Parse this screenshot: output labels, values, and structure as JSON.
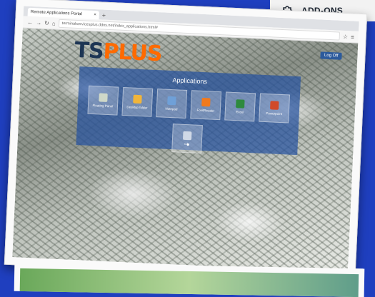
{
  "addons": {
    "label": "ADD-ONS",
    "icon": "puzzle-icon"
  },
  "browser": {
    "tab_title": "Remote Applications Portal",
    "url": "terminalservicesplus.ddns.net/index_applications.html#"
  },
  "page": {
    "logo_main": "TS",
    "logo_accent": "PLUS",
    "logoff_label": "Log Off",
    "panel_title": "Applications",
    "apps": [
      {
        "label": "Floating Panel",
        "color": "#cfd8c8"
      },
      {
        "label": "Desktop folder",
        "color": "#f1b53a"
      },
      {
        "label": "Notepad",
        "color": "#6fa0d8"
      },
      {
        "label": "FoxitReader",
        "color": "#f07a1e"
      },
      {
        "label": "Excel",
        "color": "#2e8a3e"
      },
      {
        "label": "Powerpoint",
        "color": "#d04a2a"
      }
    ],
    "app_row2": {
      "label": "cdc",
      "color": "#cfd8e6"
    }
  }
}
